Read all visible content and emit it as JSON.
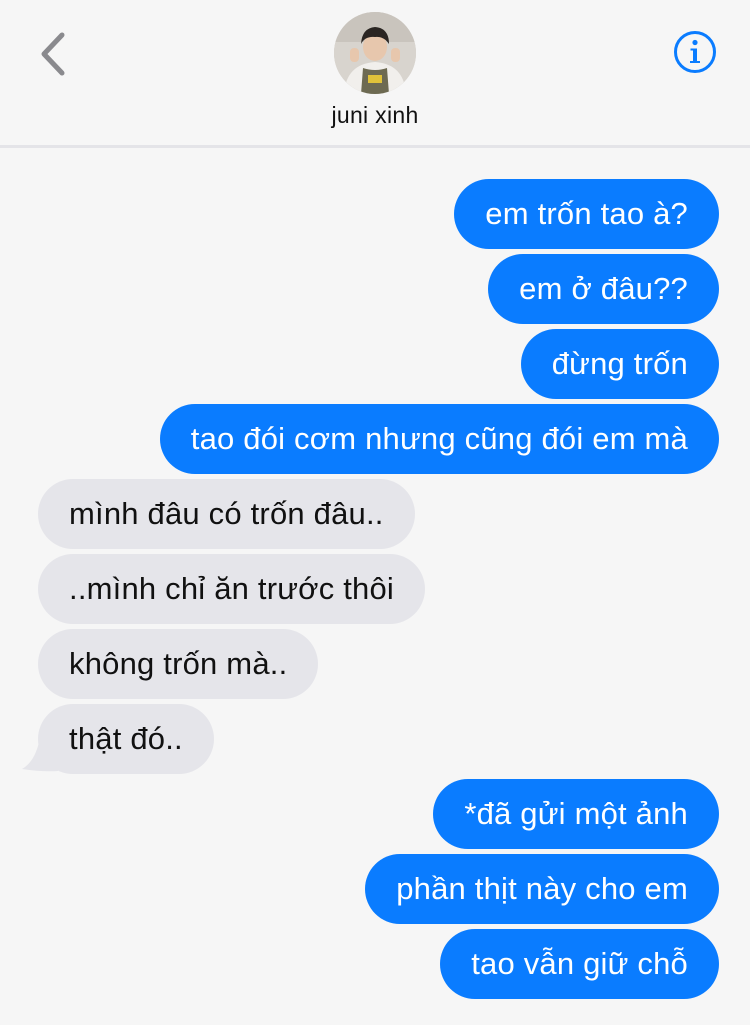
{
  "header": {
    "contact_name": "juni xinh",
    "back_icon": "chevron-left-icon",
    "info_icon": "info-circle-icon",
    "accent_color": "#0a7cff"
  },
  "messages": [
    {
      "direction": "outgoing",
      "text": "em trốn tao à?"
    },
    {
      "direction": "outgoing",
      "text": "em ở đâu??"
    },
    {
      "direction": "outgoing",
      "text": "đừng trốn"
    },
    {
      "direction": "outgoing",
      "text": "tao đói cơm nhưng cũng đói em mà"
    },
    {
      "direction": "incoming",
      "text": "mình đâu có trốn đâu.."
    },
    {
      "direction": "incoming",
      "text": "..mình chỉ ăn trước thôi"
    },
    {
      "direction": "incoming",
      "text": "không trốn mà.."
    },
    {
      "direction": "incoming",
      "text": "thật đó.."
    },
    {
      "direction": "outgoing",
      "text": "*đã gửi một ảnh"
    },
    {
      "direction": "outgoing",
      "text": "phần thịt này cho em"
    },
    {
      "direction": "outgoing",
      "text": "tao vẫn giữ chỗ"
    }
  ]
}
